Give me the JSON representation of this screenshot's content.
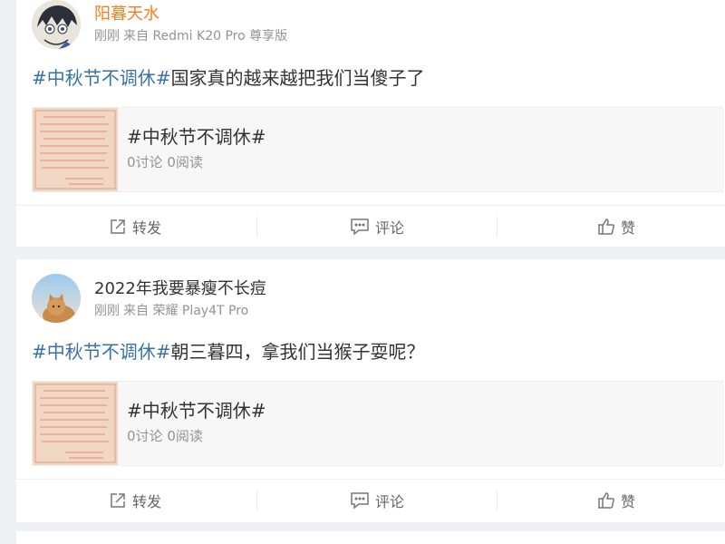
{
  "posts": [
    {
      "username": "阳暮天水",
      "meta": {
        "time": "刚刚",
        "source": "来自 Redmi K20 Pro 尊享版"
      },
      "text": {
        "hashtag": "#中秋节不调休#",
        "body": "国家真的越来越把我们当傻子了"
      },
      "topic": {
        "title": "#中秋节不调休#",
        "discussions": "0讨论",
        "reads": "0阅读"
      },
      "actions": {
        "repost": "转发",
        "comment": "评论",
        "like": "赞"
      }
    },
    {
      "username": "2022年我要暴瘦不长痘",
      "meta": {
        "time": "刚刚",
        "source": "来自 荣耀 Play4T Pro"
      },
      "text": {
        "hashtag": "#中秋节不调休#",
        "body": "朝三暮四，拿我们当猴子耍呢？"
      },
      "topic": {
        "title": "#中秋节不调休#",
        "discussions": "0讨论",
        "reads": "0阅读"
      },
      "actions": {
        "repost": "转发",
        "comment": "评论",
        "like": "赞"
      }
    }
  ],
  "colors": {
    "hashtag": "#3a72a6",
    "username_highlight": "#ff7a1a",
    "meta_gray": "#939393",
    "page_background": "#eef0f3"
  },
  "icons": {
    "repost": "share-square-icon",
    "comment": "comment-bubble-icon",
    "like": "thumbs-up-icon"
  }
}
